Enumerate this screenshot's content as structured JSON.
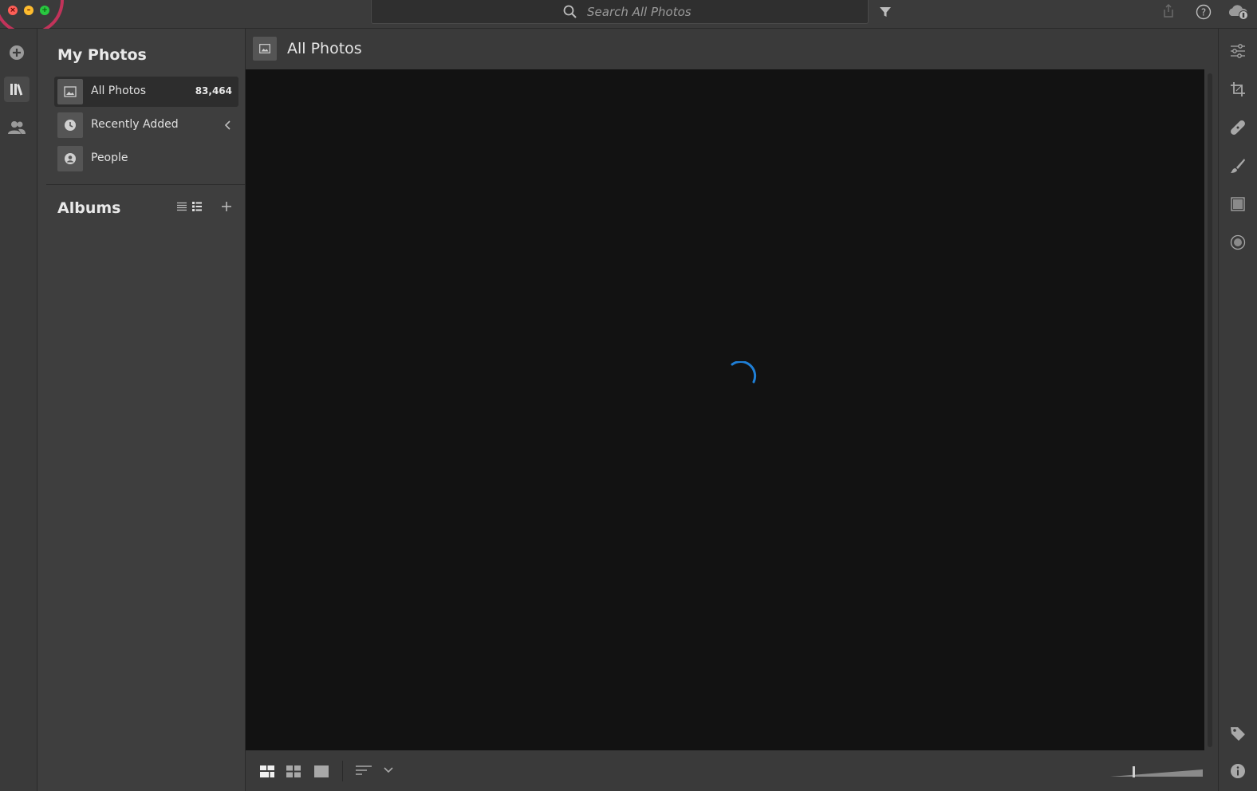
{
  "app": {
    "search_placeholder": "Search All Photos",
    "accent_color": "#1f7fd6"
  },
  "window_controls": [
    "close",
    "minimize",
    "maximize"
  ],
  "left_rail": {
    "items": [
      {
        "name": "add-photos-icon"
      },
      {
        "name": "library-icon"
      },
      {
        "name": "people-icon"
      }
    ]
  },
  "sidebar": {
    "my_photos_title": "My Photos",
    "items": [
      {
        "label": "All Photos",
        "count": "83,464",
        "icon": "photo-icon",
        "active": true
      },
      {
        "label": "Recently Added",
        "count": "",
        "icon": "clock-icon",
        "active": false
      },
      {
        "label": "People",
        "count": "",
        "icon": "person-icon",
        "active": false
      }
    ],
    "albums_title": "Albums"
  },
  "main": {
    "title": "All Photos",
    "loading": true
  },
  "right_rail": {
    "items": [
      "edit-sliders-icon",
      "crop-icon",
      "healing-icon",
      "brush-icon",
      "gradient-icon",
      "radial-icon",
      "tag-icon",
      "info-icon"
    ]
  }
}
